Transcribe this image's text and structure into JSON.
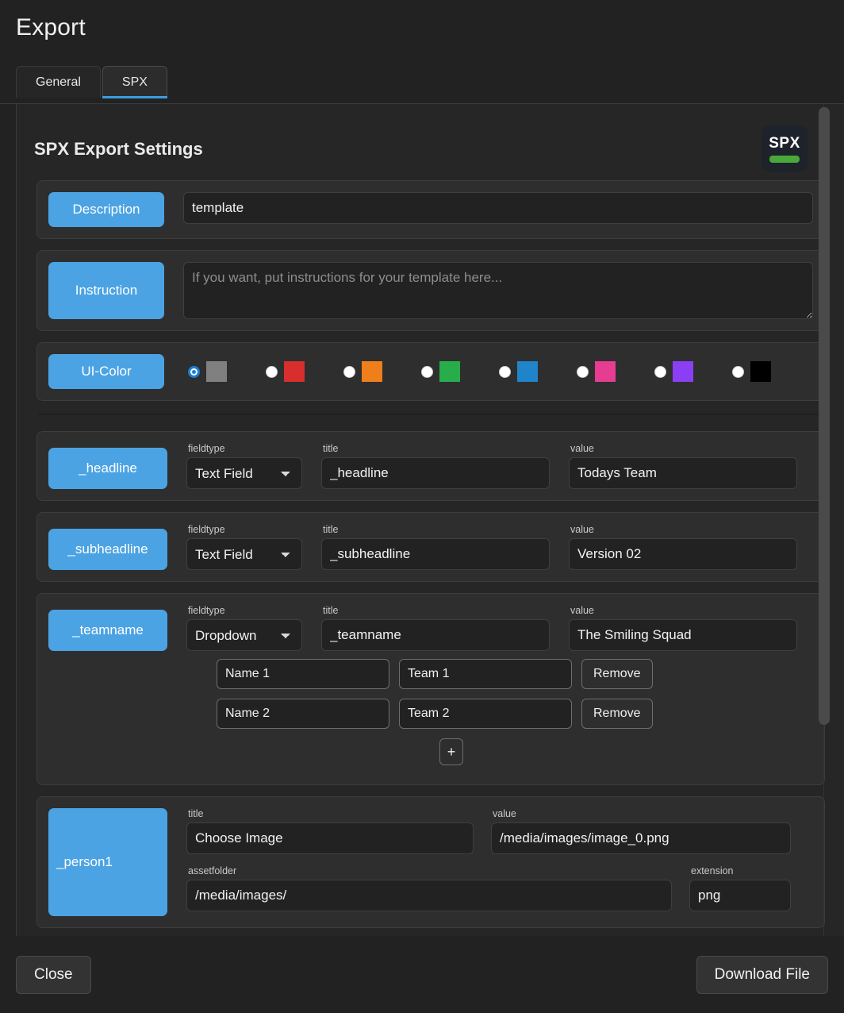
{
  "window": {
    "title": "Export"
  },
  "tabs": [
    {
      "id": "general",
      "label": "General",
      "active": false
    },
    {
      "id": "spx",
      "label": "SPX",
      "active": true
    }
  ],
  "panel": {
    "title": "SPX Export Settings",
    "logo": {
      "text": "SPX",
      "bar_color": "#4aa83a",
      "bg_color": "#1e232b"
    }
  },
  "description": {
    "label": "Description",
    "value": "template"
  },
  "instruction": {
    "label": "Instruction",
    "value": "",
    "placeholder": "If you want, put instructions for your template here..."
  },
  "ui_color": {
    "label": "UI-Color",
    "selected_index": 0,
    "options": [
      {
        "name": "gray",
        "color": "#808080",
        "selected": true
      },
      {
        "name": "red",
        "color": "#d82e2e",
        "selected": false
      },
      {
        "name": "orange",
        "color": "#ef7f1a",
        "selected": false
      },
      {
        "name": "green",
        "color": "#27ad4a",
        "selected": false
      },
      {
        "name": "blue",
        "color": "#1f84c9",
        "selected": false
      },
      {
        "name": "pink",
        "color": "#e63d92",
        "selected": false
      },
      {
        "name": "purple",
        "color": "#8b3ff5",
        "selected": false
      },
      {
        "name": "black",
        "color": "#000000",
        "selected": false
      }
    ]
  },
  "labels": {
    "fieldtype": "fieldtype",
    "title": "title",
    "value": "value",
    "assetfolder": "assetfolder",
    "extension": "extension",
    "remove": "Remove",
    "add": "+"
  },
  "fields": [
    {
      "chip": "_headline",
      "fieldtype": "Text Field",
      "fieldtype_options": [
        "Text Field",
        "Dropdown"
      ],
      "title": "_headline",
      "value": "Todays Team"
    },
    {
      "chip": "_subheadline",
      "fieldtype": "Text Field",
      "fieldtype_options": [
        "Text Field",
        "Dropdown"
      ],
      "title": "_subheadline",
      "value": "Version 02"
    },
    {
      "chip": "_teamname",
      "fieldtype": "Dropdown",
      "fieldtype_options": [
        "Text Field",
        "Dropdown"
      ],
      "title": "_teamname",
      "value": "The Smiling Squad",
      "options": [
        {
          "name": "Name 1",
          "team": "Team 1",
          "remove": "Remove"
        },
        {
          "name": "Name 2",
          "team": "Team 2",
          "remove": "Remove"
        }
      ]
    }
  ],
  "image_field": {
    "chip": "_person1",
    "title": "Choose Image",
    "value": "/media/images/image_0.png",
    "assetfolder": "/media/images/",
    "extension": "png"
  },
  "footer": {
    "close_label": "Close",
    "download_label": "Download File"
  }
}
